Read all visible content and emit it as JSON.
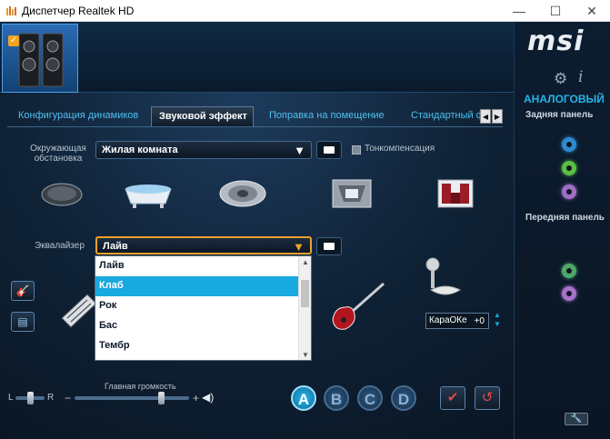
{
  "window": {
    "title": "Диспетчер Realtek HD",
    "minimize": "—",
    "maximize": "☐",
    "close": "✕"
  },
  "brand": {
    "logo": "msi"
  },
  "side": {
    "mode": "АНАЛОГОВЫЙ",
    "back_panel": "Задняя панель",
    "front_panel": "Передняя панель",
    "back_jacks": [
      "#2f8ad0",
      "#5bbf44",
      "#9f6fc4"
    ],
    "front_jacks": [
      "#4fa86a",
      "#a772c9"
    ]
  },
  "tabs": [
    {
      "label": "Конфигурация динамиков",
      "active": false
    },
    {
      "label": "Звуковой эффект",
      "active": true
    },
    {
      "label": "Поправка на помещение",
      "active": false
    },
    {
      "label": "Стандартный ф",
      "active": false
    }
  ],
  "environment": {
    "label_line1": "Окружающая",
    "label_line2": "обстановка",
    "value": "Жилая комната",
    "loudness_label": "Тонкомпенсация"
  },
  "equalizer": {
    "label": "Эквалайзер",
    "value": "Лайв",
    "options": [
      {
        "label": "Лайв",
        "selected": false
      },
      {
        "label": "Клаб",
        "selected": true
      },
      {
        "label": "Рок",
        "selected": false
      },
      {
        "label": "Бас",
        "selected": false
      },
      {
        "label": "Тембр",
        "selected": false
      }
    ]
  },
  "karaoke": {
    "label": "КараОКе",
    "value": "+0"
  },
  "volume": {
    "left": "L",
    "right": "R",
    "label": "Главная громкость",
    "minus": "−",
    "plus": "+",
    "balance": 0.5,
    "level": 0.75
  },
  "profiles": [
    "A",
    "B",
    "C",
    "D"
  ],
  "colors": {
    "accent": "#28b3e8",
    "selection": "#18a9de",
    "background": "#0d1a2a"
  }
}
